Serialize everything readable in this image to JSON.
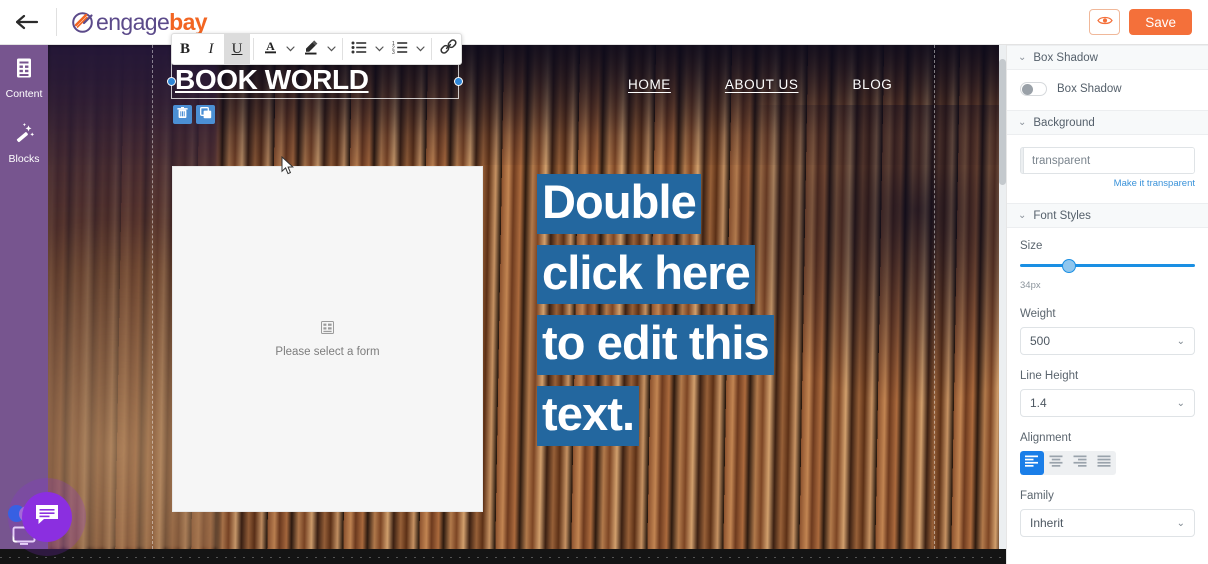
{
  "topbar": {
    "back_icon": "arrow-left-icon",
    "logo_engage": "engage",
    "logo_bay": "bay",
    "preview_icon": "eye-icon",
    "save_label": "Save"
  },
  "sidebar": {
    "items": [
      {
        "label": "Content",
        "icon": "document-icon"
      },
      {
        "label": "Blocks",
        "icon": "magic-wand-icon"
      }
    ],
    "device": {
      "icon": "desktop-icon"
    },
    "chat_icon": "chat-bubble-icon"
  },
  "format_toolbar": {
    "bold": "B",
    "italic": "I",
    "underline": "U",
    "font_color_icon": "font-color-icon",
    "highlight_icon": "highlighter-icon",
    "bullet_list_icon": "bullet-list-icon",
    "numbered_list_icon": "numbered-list-icon",
    "link_icon": "link-icon",
    "caret": "⌄"
  },
  "canvas": {
    "site_title": "BOOK WORLD",
    "nav": [
      {
        "label": "HOME",
        "underlined": true
      },
      {
        "label": "ABOUT US",
        "underlined": true
      },
      {
        "label": "BLOG",
        "underlined": false
      }
    ],
    "block_actions": [
      {
        "name": "delete",
        "icon": "trash-icon"
      },
      {
        "name": "duplicate",
        "icon": "copy-icon"
      }
    ],
    "form_placeholder": {
      "icon": "form-icon",
      "text": "Please select a form"
    },
    "hero_lines": [
      "Double",
      "click here",
      "to edit this",
      "text."
    ],
    "highlight_color": "#23679f"
  },
  "right_panel": {
    "sections": [
      {
        "title": "Box Shadow",
        "toggle_label": "Box Shadow"
      },
      {
        "title": "Background",
        "bg_value": "transparent",
        "bg_placeholder": "transparent",
        "make_transparent": "Make it transparent"
      },
      {
        "title": "Font Styles",
        "size_label": "Size",
        "size_value": "34px",
        "weight_label": "Weight",
        "weight_value": "500",
        "line_height_label": "Line Height",
        "line_height_value": "1.4",
        "alignment_label": "Alignment",
        "alignment_options": [
          "left",
          "center",
          "right",
          "justify"
        ],
        "alignment_selected": "left",
        "family_label": "Family",
        "family_value": "Inherit"
      }
    ]
  }
}
